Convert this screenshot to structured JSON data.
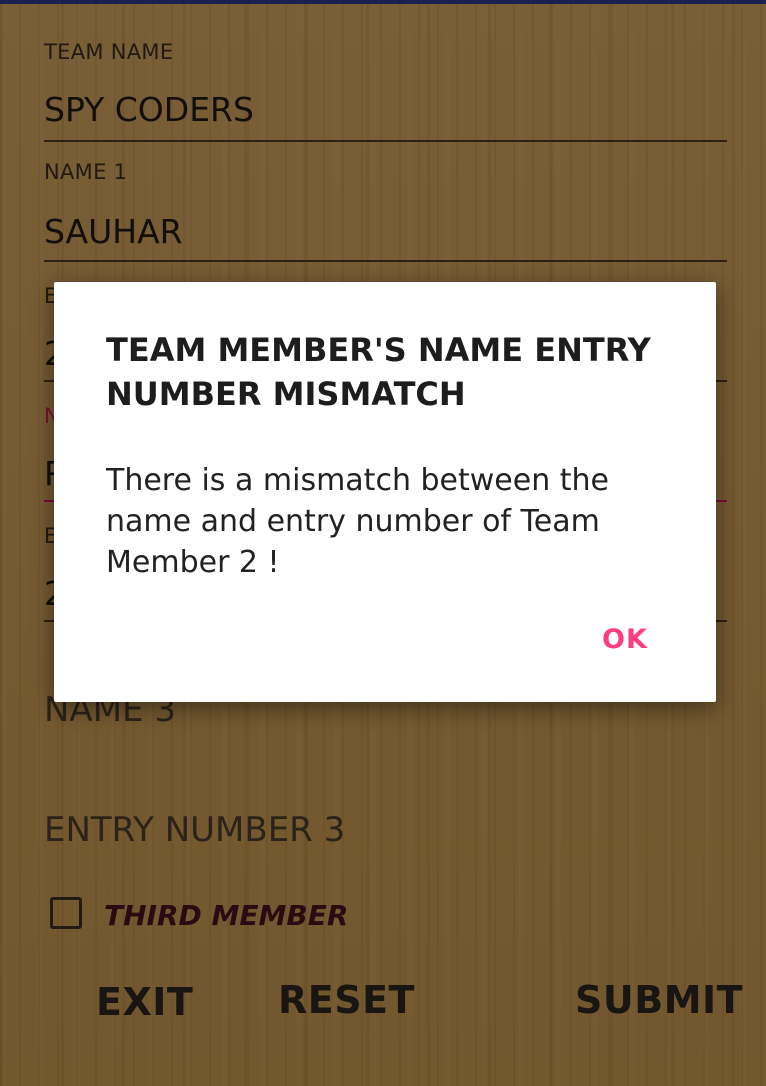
{
  "form": {
    "team_name_label": "TEAM NAME",
    "team_name_value": "SPY CODERS",
    "name1_label": "NAME 1",
    "name1_value": "SAUHAR",
    "entry1_label_partial": "E",
    "entry1_value_partial": "2",
    "name2_label_partial": "N",
    "name2_value_partial": "R",
    "entry2_label_partial": "E",
    "entry2_value_partial": "2",
    "name3_placeholder": "NAME 3",
    "entry3_placeholder": "ENTRY NUMBER 3",
    "third_member_label": "THIRD MEMBER",
    "third_member_checked": false
  },
  "buttons": {
    "exit": "EXIT",
    "reset": "RESET",
    "submit": "SUBMIT"
  },
  "dialog": {
    "title": "TEAM MEMBER'S NAME ENTRY NUMBER MISMATCH",
    "message": "There is a mismatch between the name and entry number of Team Member 2 !",
    "ok": "OK"
  },
  "colors": {
    "accent": "#ff3d7f",
    "focused_underline": "#d8165f",
    "status_bar": "#2b3a8a"
  }
}
